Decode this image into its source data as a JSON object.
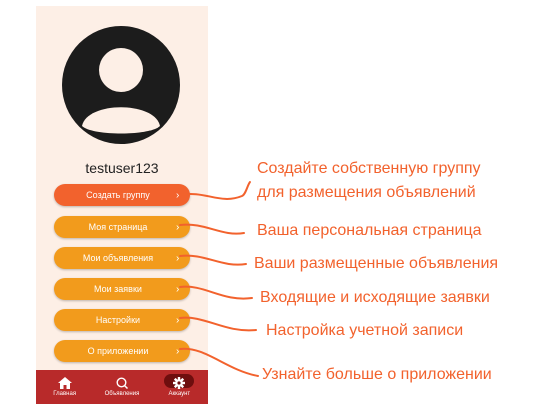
{
  "profile": {
    "username": "testuser123"
  },
  "menu": [
    {
      "label": "Создать группу",
      "style": "primary"
    },
    {
      "label": "Моя страница",
      "style": "secondary"
    },
    {
      "label": "Мои объявления",
      "style": "secondary"
    },
    {
      "label": "Мои заявки",
      "style": "secondary"
    },
    {
      "label": "Настройки",
      "style": "secondary"
    },
    {
      "label": "О приложении",
      "style": "secondary"
    }
  ],
  "tabbar": [
    {
      "label": "Главная",
      "icon": "home-icon",
      "active": false
    },
    {
      "label": "Объявления",
      "icon": "search-icon",
      "active": false
    },
    {
      "label": "Аккаунт",
      "icon": "gear-icon",
      "active": true
    }
  ],
  "annotations": [
    {
      "line1": "Создайте собственную группу",
      "line2": "для размещения объявлений"
    },
    {
      "text": "Ваша персональная страница"
    },
    {
      "text": "Ваши размещенные объявления"
    },
    {
      "text": "Входящие и исходящие заявки"
    },
    {
      "text": "Настройка учетной записи"
    },
    {
      "text": "Узнайте больше о приложении"
    }
  ],
  "colors": {
    "primary_button": "#f2622d",
    "secondary_button": "#f29b1c",
    "tabbar": "#b82a2a",
    "annotation": "#f2622d",
    "background": "#fdefe6"
  }
}
